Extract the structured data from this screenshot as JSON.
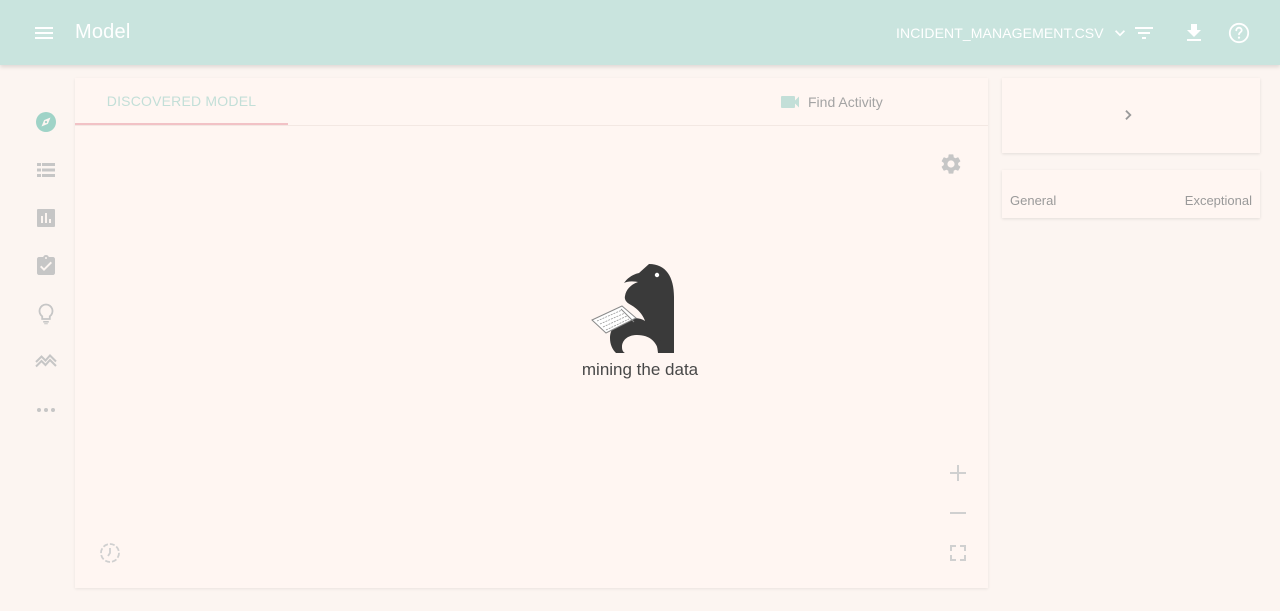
{
  "header": {
    "title": "Model",
    "file_name": "INCIDENT_MANAGEMENT.CSV",
    "icons": [
      "menu-icon",
      "chevron-down-icon",
      "filter-icon",
      "download-icon",
      "help-icon"
    ]
  },
  "rail": {
    "items": [
      "compass-icon",
      "list-icon",
      "chart-icon",
      "assignment-check-icon",
      "lightbulb-icon",
      "trend-icon",
      "more-icon"
    ],
    "active": "compass-icon"
  },
  "main": {
    "tab_label": "DISCOVERED MODEL",
    "find_activity_label": "Find Activity",
    "loading_text": "mining the data"
  },
  "side": {
    "tabs": [
      "General",
      "Exceptional"
    ]
  },
  "colors": {
    "header_bg": "#c9e4de",
    "page_bg": "#fcf5f1",
    "card_bg": "#fff6f2",
    "active_icon": "#9fd3c7",
    "tab_indicator": "#f2c2c6"
  }
}
